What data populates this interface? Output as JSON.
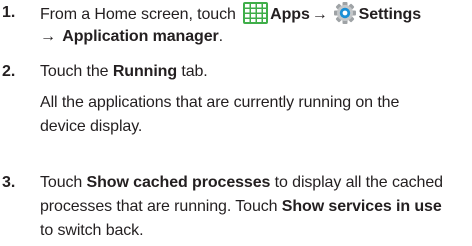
{
  "steps": [
    {
      "number": "1.",
      "text_a": "From a Home screen, touch ",
      "apps": "Apps",
      "arrow1": "→",
      "settings": "Settings",
      "arrow2": "→",
      "app_manager": "Application manager",
      "period": "."
    },
    {
      "number": "2.",
      "text_a": "Touch the ",
      "running": "Running",
      "text_b": " tab.",
      "line2": "All the applications that are currently running on the",
      "line3": "device display."
    },
    {
      "number": "3.",
      "text_a": "Touch ",
      "show_cached": "Show cached processes",
      "text_b": " to display all the cached",
      "line2a": "processes that are running. Touch ",
      "show_services": "Show services in use",
      "line3": "to switch back."
    }
  ],
  "colors": {
    "apps_icon": "#3fae49",
    "settings_icon": "#1a8fd6",
    "text": "#231f20"
  },
  "icons": {
    "apps": "apps-grid-icon",
    "settings": "settings-gear-icon"
  }
}
